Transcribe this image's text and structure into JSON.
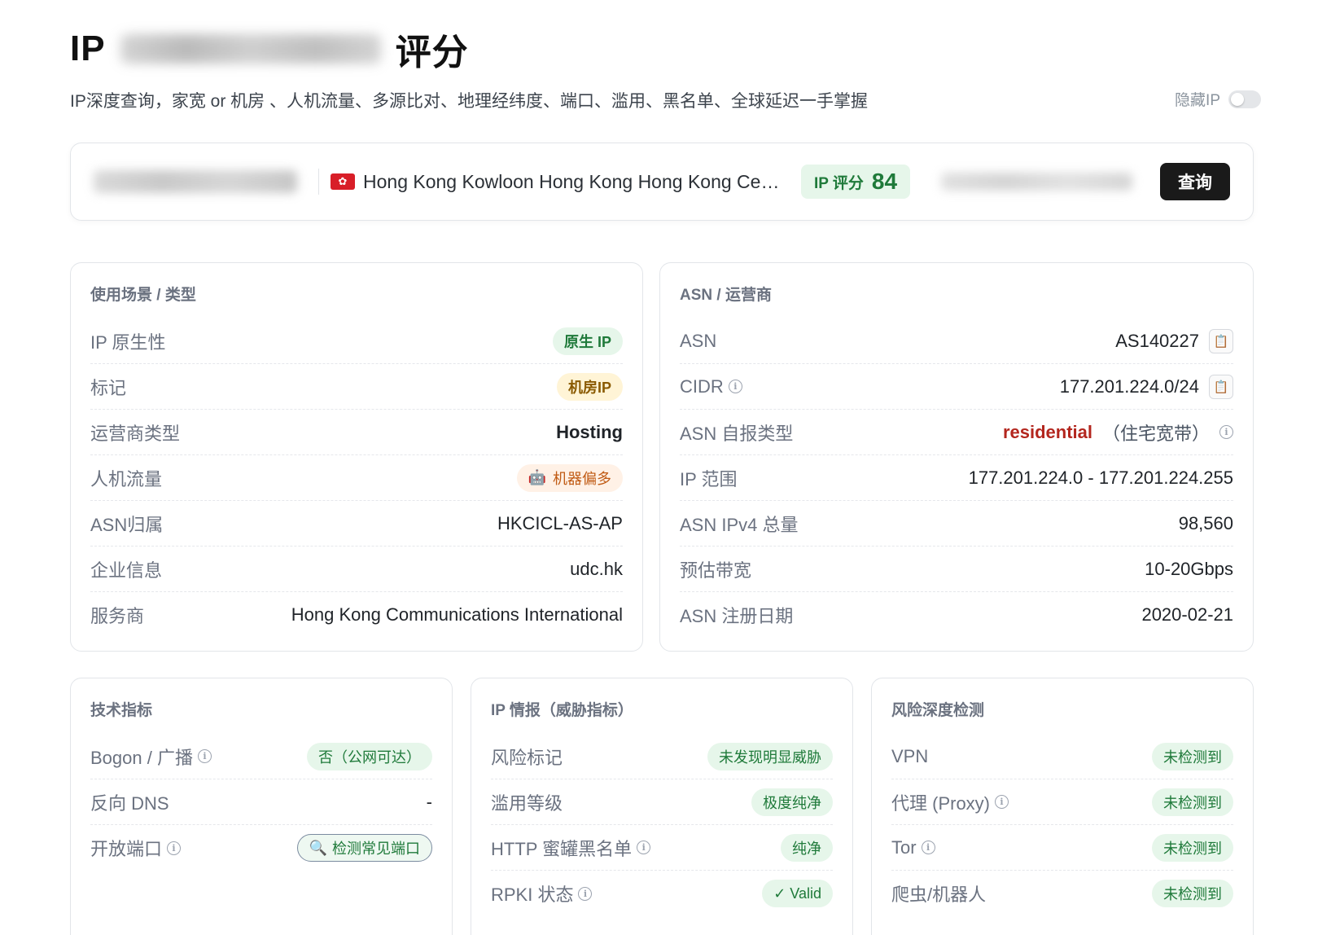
{
  "header": {
    "title_prefix": "IP",
    "title_suffix": "评分",
    "subtitle": "IP深度查询，家宽 or 机房 、人机流量、多源比对、地理经纬度、端口、滥用、黑名单、全球延迟一手掌握",
    "hide_ip_label": "隐藏IP"
  },
  "search": {
    "location": "Hong Kong Kowloon Hong Kong Hong Kong Central",
    "score_label": "IP 评分",
    "score_value": "84",
    "query_button": "查询"
  },
  "usage_card": {
    "title": "使用场景 / 类型",
    "rows": [
      {
        "label": "IP 原生性",
        "value": "原生 IP"
      },
      {
        "label": "标记",
        "value": "机房IP"
      },
      {
        "label": "运营商类型",
        "value": "Hosting"
      },
      {
        "label": "人机流量",
        "value": "机器偏多"
      },
      {
        "label": "ASN归属",
        "value": "HKCICL-AS-AP"
      },
      {
        "label": "企业信息",
        "value": "udc.hk"
      },
      {
        "label": "服务商",
        "value": "Hong Kong Communications International"
      }
    ]
  },
  "asn_card": {
    "title": "ASN / 运营商",
    "rows": [
      {
        "label": "ASN",
        "value": "AS140227"
      },
      {
        "label": "CIDR",
        "value": "177.201.224.0/24"
      },
      {
        "label": "ASN 自报类型",
        "value": "residential",
        "extra": "（住宅宽带）"
      },
      {
        "label": "IP 范围",
        "value": "177.201.224.0 - 177.201.224.255"
      },
      {
        "label": "ASN IPv4 总量",
        "value": "98,560"
      },
      {
        "label": "预估带宽",
        "value": "10-20Gbps"
      },
      {
        "label": "ASN 注册日期",
        "value": "2020-02-21"
      }
    ]
  },
  "tech_card": {
    "title": "技术指标",
    "rows": [
      {
        "label": "Bogon / 广播",
        "value": "否（公网可达）"
      },
      {
        "label": "反向 DNS",
        "value": "-"
      },
      {
        "label": "开放端口",
        "value": "检测常见端口"
      }
    ]
  },
  "intel_card": {
    "title": "IP 情报（威胁指标）",
    "rows": [
      {
        "label": "风险标记",
        "value": "未发现明显威胁"
      },
      {
        "label": "滥用等级",
        "value": "极度纯净"
      },
      {
        "label": "HTTP 蜜罐黑名单",
        "value": "纯净"
      },
      {
        "label": "RPKI 状态",
        "value": "✓ Valid"
      }
    ]
  },
  "risk_card": {
    "title": "风险深度检测",
    "rows": [
      {
        "label": "VPN",
        "value": "未检测到"
      },
      {
        "label": "代理 (Proxy)",
        "value": "未检测到"
      },
      {
        "label": "Tor",
        "value": "未检测到"
      },
      {
        "label": "爬虫/机器人",
        "value": "未检测到"
      }
    ]
  },
  "colors": {
    "accent_green": "#1f7a3a",
    "residential_red": "#b3261e",
    "button_dark": "#1a1a1a"
  }
}
